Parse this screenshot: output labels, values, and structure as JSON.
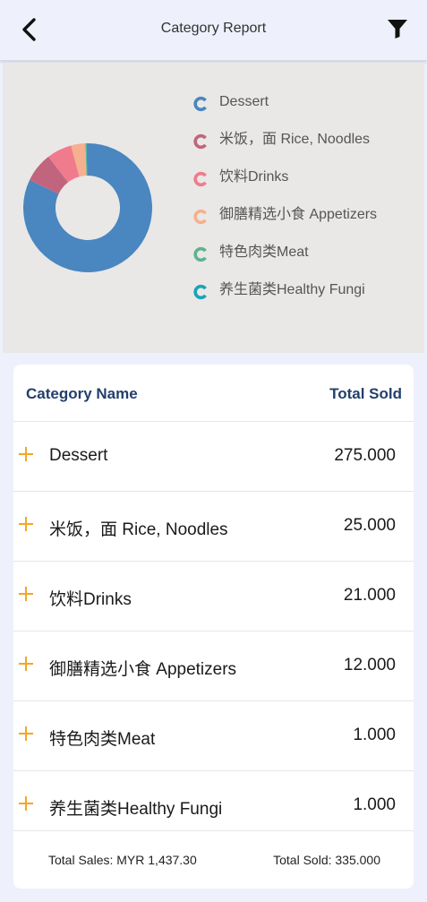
{
  "header": {
    "title": "Category Report",
    "back_icon": "chevron-left-icon",
    "filter_icon": "filter-icon"
  },
  "chart_data": {
    "type": "pie",
    "categories": [
      "Dessert",
      "米饭，面 Rice, Noodles",
      "饮料Drinks",
      "御膳精选小食 Appetizers",
      "特色肉类Meat",
      "养生菌类Healthy Fungi"
    ],
    "values": [
      275.0,
      25.0,
      21.0,
      12.0,
      1.0,
      1.0
    ],
    "colors": [
      "#4a86c0",
      "#c0657d",
      "#f07b8c",
      "#f6b08f",
      "#5eb391",
      "#1aa3b8"
    ],
    "legend_position": "right",
    "donut": true
  },
  "table": {
    "col_name": "Category Name",
    "col_total": "Total Sold",
    "rows": [
      {
        "name": "Dessert",
        "total": "275.000"
      },
      {
        "name": "米饭，面 Rice, Noodles",
        "total": "25.000"
      },
      {
        "name": "饮料Drinks",
        "total": "21.000"
      },
      {
        "name": "御膳精选小食 Appetizers",
        "total": "12.000"
      },
      {
        "name": "特色肉类Meat",
        "total": "1.000"
      },
      {
        "name": "养生菌类Healthy Fungi",
        "total": "1.000"
      }
    ]
  },
  "footer": {
    "total_sales": "Total Sales:  MYR 1,437.30",
    "total_sold": "Total Sold: 335.000"
  },
  "colors": {
    "plus_icon": "#f5a623",
    "header_text": "#233f6b"
  }
}
